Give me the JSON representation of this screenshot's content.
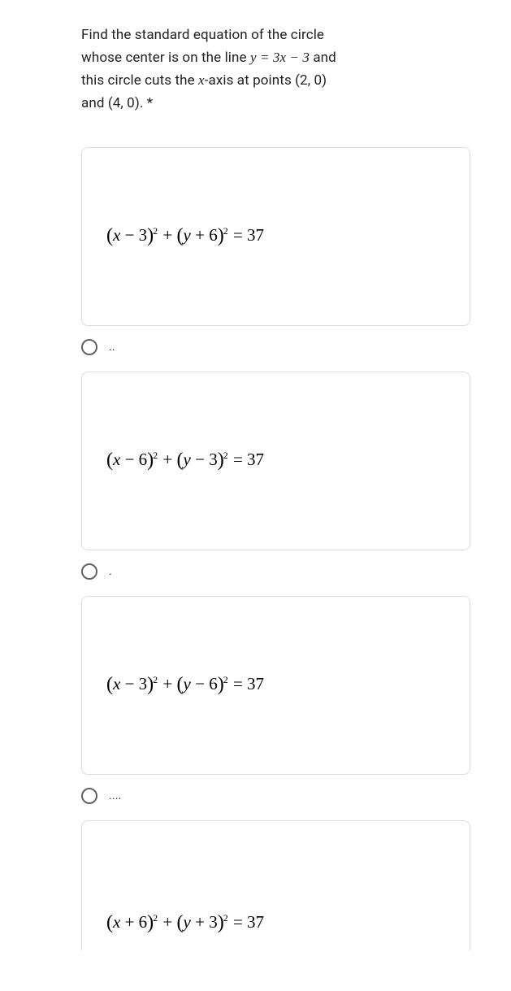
{
  "question": {
    "line1": "Find the standard equation of the circle",
    "line2_pre": "whose center is on the line ",
    "line2_eq": "y = 3x − 3",
    "line2_post": " and",
    "line3_pre": "this circle cuts the ",
    "line3_xaxis": "x",
    "line3_post": "-axis at points (2, 0)",
    "line4": "and (4, 0). *"
  },
  "options": [
    {
      "equation_parts": {
        "a_sign": "−",
        "a_val": "3",
        "b_sign": "+",
        "b_val": "6",
        "rhs": "37"
      },
      "radio_label": ".."
    },
    {
      "equation_parts": {
        "a_sign": "−",
        "a_val": "6",
        "b_sign": "−",
        "b_val": "3",
        "rhs": "37"
      },
      "radio_label": "."
    },
    {
      "equation_parts": {
        "a_sign": "−",
        "a_val": "3",
        "b_sign": "−",
        "b_val": "6",
        "rhs": "37"
      },
      "radio_label": "...."
    },
    {
      "equation_parts": {
        "a_sign": "+",
        "a_val": "6",
        "b_sign": "+",
        "b_val": "3",
        "rhs": "37"
      },
      "radio_label": null
    }
  ]
}
